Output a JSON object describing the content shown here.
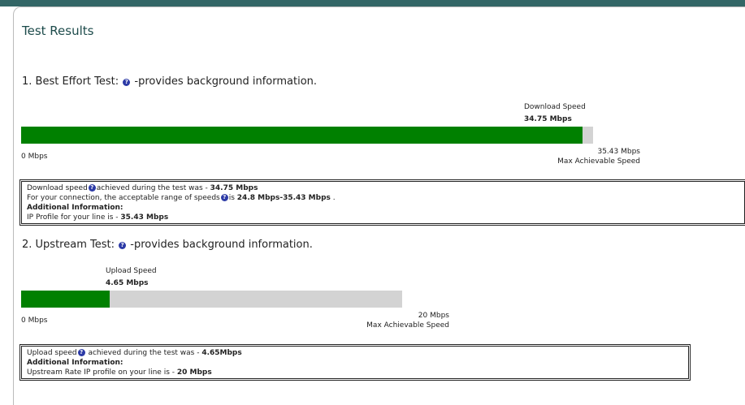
{
  "page": {
    "title": "Test Results"
  },
  "best_effort": {
    "heading_prefix": "1. Best Effort Test:",
    "heading_suffix": "-provides background information.",
    "speed_label": "Download Speed",
    "speed_value": "34.75 Mbps",
    "min_label": "0 Mbps",
    "max_value": "35.43 Mbps",
    "max_label": "Max Achievable Speed",
    "fill_fraction": 0.981,
    "info": {
      "line1_prefix": "Download speed",
      "line1_mid": "achieved during the test was - ",
      "line1_value": "34.75 Mbps",
      "line2_prefix": "For your connection, the acceptable range of speeds",
      "line2_mid": "is ",
      "line2_value": "24.8 Mbps-35.43 Mbps",
      "line2_end": " .",
      "additional": "Additional Information:",
      "line4_prefix": "IP Profile for your line is - ",
      "line4_value": "35.43 Mbps"
    }
  },
  "upstream": {
    "heading_prefix": "2. Upstream Test:",
    "heading_suffix": "-provides background information.",
    "speed_label": "Upload Speed",
    "speed_value": "4.65 Mbps",
    "min_label": "0 Mbps",
    "max_value": "20 Mbps",
    "max_label": "Max Achievable Speed",
    "fill_fraction": 0.2325,
    "info": {
      "line1_prefix": "Upload speed",
      "line1_mid": " achieved during the test was - ",
      "line1_value": "4.65Mbps",
      "additional": "Additional Information:",
      "line3_prefix": "Upstream Rate IP profile on your line is - ",
      "line3_value": "20 Mbps"
    }
  },
  "icons": {
    "help": "question-circle-icon",
    "help_glyph": "?"
  },
  "colors": {
    "bar_fill": "#008000",
    "bar_track": "#d3d3d3",
    "top_bar": "#336666",
    "help_icon": "#2c3aa6"
  }
}
